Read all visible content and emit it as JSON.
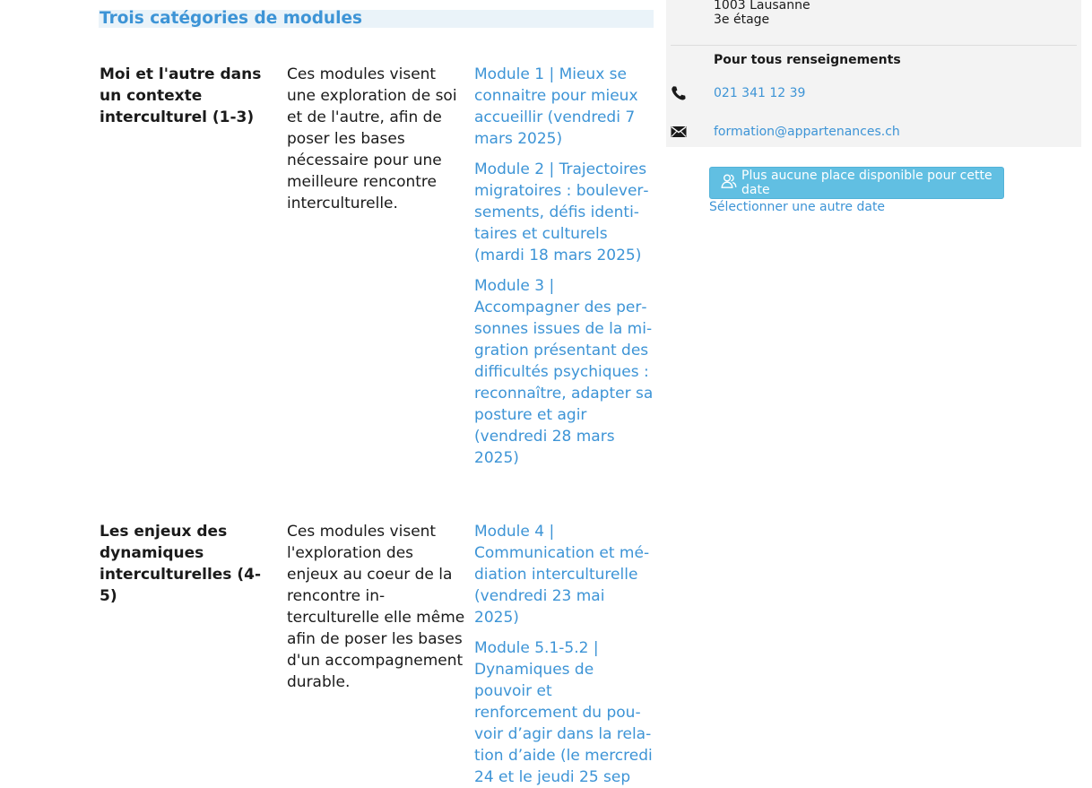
{
  "section": {
    "heading": "Trois catégories de modules"
  },
  "categories": [
    {
      "title": "Moi et l'autre dans un contexte interculturel (1-3)",
      "description": "Ces modules visent une exploration de soi et de l'autre, afin de poser les bases nécessaire pour une meilleure rencontre interculturelle.",
      "modules": [
        "Module 1 | Mieux se connaitre pour mieux accueillir (vendredi 7 mars 2025)",
        "Module 2 | Trajectoires migratoires : boulever­sements, défis identi­taires et culturels (mardi 18 mars 2025)",
        "Module 3 | Accompagner des per­sonnes issues de la mi­gration présentant des difficultés psychiques : reconnaître, adapter sa posture et agir (vendredi 28 mars 2025)"
      ]
    },
    {
      "title": "Les enjeux des dyna­miques interculturelles (4-5)",
      "description": "Ces modules visent l'ex­ploration des enjeux au coeur de la rencontre in­terculturelle elle même afin de poser les bases d'un accompagnement durable.",
      "modules": [
        "Module 4 | Communication et mé­diation interculturelle (vendredi 23 mai 2025)",
        "Module 5.1-5.2 | Dynamiques de pouvoir et renforcement du pou­voir d’agir dans la rela­tion d’aide (le mercredi 24 et le jeudi 25 sep"
      ]
    }
  ],
  "sidebar": {
    "address_city": "1003 Lausanne",
    "address_floor": "3e étage",
    "info_heading": "Pour tous renseignements",
    "phone": "021 341 12 39",
    "email": "formation@appartenances.ch"
  },
  "booking": {
    "button_label": "Plus aucune place disponible pour cette date",
    "other_date_label": "Sélectionner une autre date"
  },
  "colors": {
    "accent": "#3d94d6",
    "button": "#61bfe2",
    "heading_bg": "#eaf3f9",
    "sidebar_bg": "#f3f3f3"
  },
  "icons": [
    "phone-icon",
    "envelope-icon",
    "users-icon"
  ]
}
